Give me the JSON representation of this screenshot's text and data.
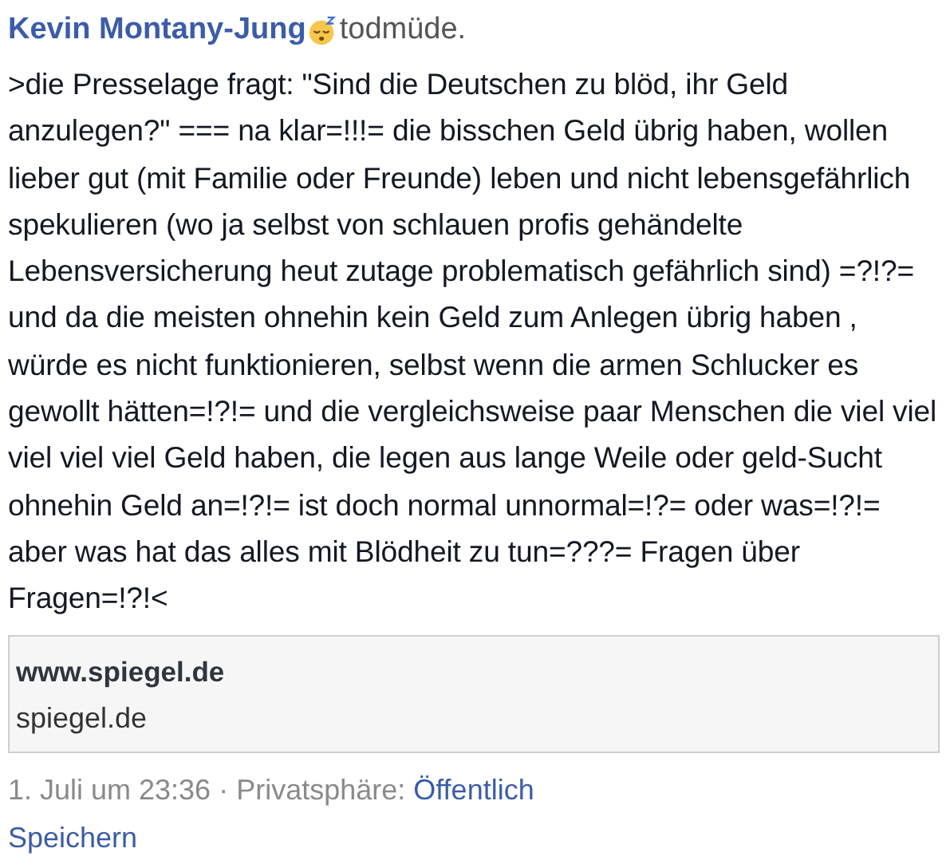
{
  "post": {
    "author": "Kevin Montany-Jung",
    "feeling": "todmüde.",
    "text": ">die Presselage fragt: \"Sind die Deutschen zu blöd, ihr Geld anzulegen?\" === na klar=!!!= die bisschen Geld übrig haben, wollen lieber gut (mit Familie oder  Freunde) leben und nicht lebensgefährlich spekulieren (wo ja selbst von schlauen profis gehändelte Lebensversicherung heut zutage problematisch gefährlich sind) =?!?= und da die meisten ohnehin kein Geld zum Anlegen übrig haben , würde es nicht funktionieren, selbst wenn die armen Schlucker es gewollt hätten=!?!= und die vergleichsweise paar Menschen die viel viel viel viel viel Geld haben, die legen aus lange Weile oder geld-Sucht ohnehin Geld an=!?!= ist doch normal unnormal=!?= oder was=!?!= aber was hat das alles mit Blödheit zu tun=???= Fragen über Fragen=!?!<",
    "link": {
      "title": "www.spiegel.de",
      "domain": "spiegel.de"
    },
    "timestamp": "1. Juli um 23:36 · Privatsphäre:",
    "privacy": "Öffentlich",
    "save": "Speichern"
  }
}
